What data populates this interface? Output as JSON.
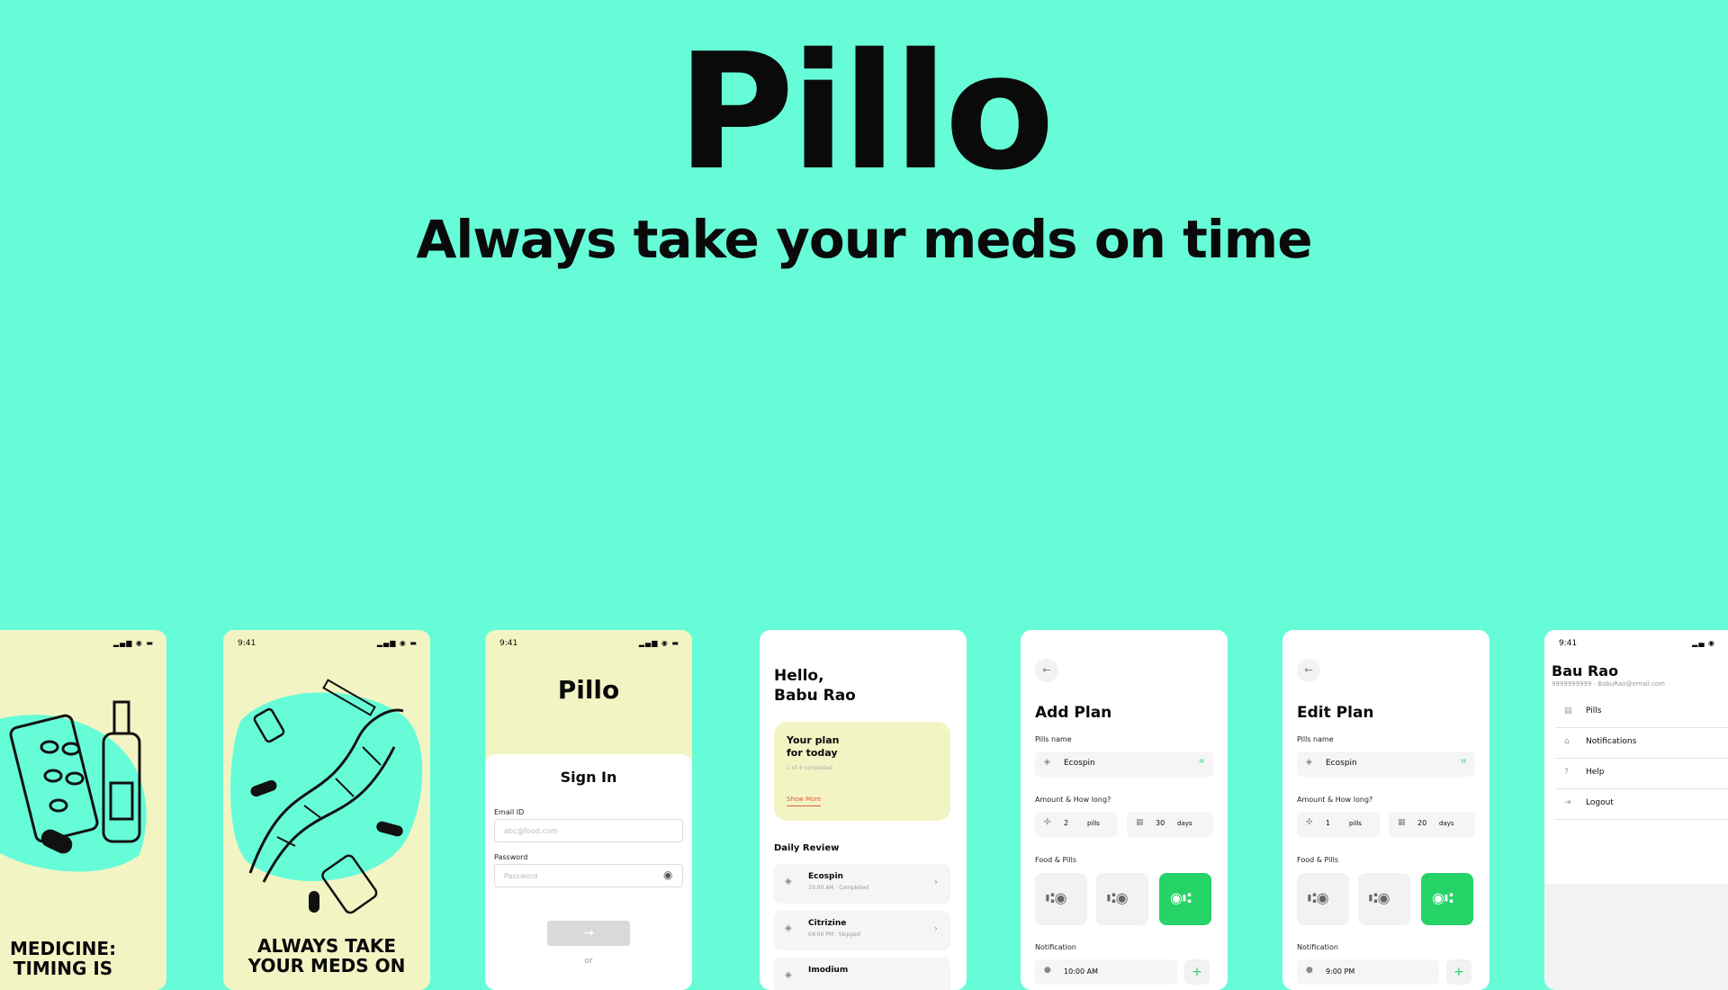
{
  "app": {
    "title": "Pillo",
    "tagline": "Always take your meds on time"
  },
  "status_time": "9:41",
  "onboarding1": {
    "caption_line1": "MEDICINE:",
    "caption_line2": "TIMING IS"
  },
  "onboarding2": {
    "caption_line1": "ALWAYS TAKE",
    "caption_line2": "YOUR MEDS ON"
  },
  "signin": {
    "brand": "Pillo",
    "heading": "Sign In",
    "email_label": "Email ID",
    "email_placeholder": "abc@food.com",
    "password_label": "Password",
    "password_placeholder": "Password",
    "submit_icon": "→",
    "or_text": "or"
  },
  "home": {
    "greeting_line1": "Hello,",
    "greeting_line2": "Babu Rao",
    "plan_line1": "Your plan",
    "plan_line2": "for today",
    "plan_progress": "1 of 4 completed",
    "show_more": "Show More",
    "daily_review_title": "Daily Review",
    "items": [
      {
        "name": "Ecospin",
        "detail": "10:00 AM · Completed"
      },
      {
        "name": "Citrizine",
        "detail": "04:00 PM · Skipped"
      },
      {
        "name": "Imodium",
        "detail": ""
      }
    ]
  },
  "add_plan": {
    "title": "Add Plan",
    "pills_label": "Pills name",
    "pill_name": "Ecospin",
    "amount_label": "Amount & How long?",
    "amount": "2",
    "amount_unit": "pills",
    "duration": "30",
    "duration_unit": "days",
    "food_label": "Food & Pills",
    "notification_label": "Notification",
    "notification_time": "10:00 AM"
  },
  "edit_plan": {
    "title": "Edit Plan",
    "pills_label": "Pills name",
    "pill_name": "Ecospin",
    "amount_label": "Amount & How long?",
    "amount": "1",
    "amount_unit": "pills",
    "duration": "20",
    "duration_unit": "days",
    "food_label": "Food & Pills",
    "notification_label": "Notification",
    "notification_time": "9:00 PM"
  },
  "profile": {
    "name": "Bau Rao",
    "contact": "9999999999 · BabuRao@email.com",
    "menu": [
      "Pills",
      "Notifications",
      "Help",
      "Logout"
    ]
  },
  "colors": {
    "background": "#66fcd8",
    "accent_green": "#25d366",
    "cream": "#f3f4c4",
    "link_red": "#e8553d"
  }
}
